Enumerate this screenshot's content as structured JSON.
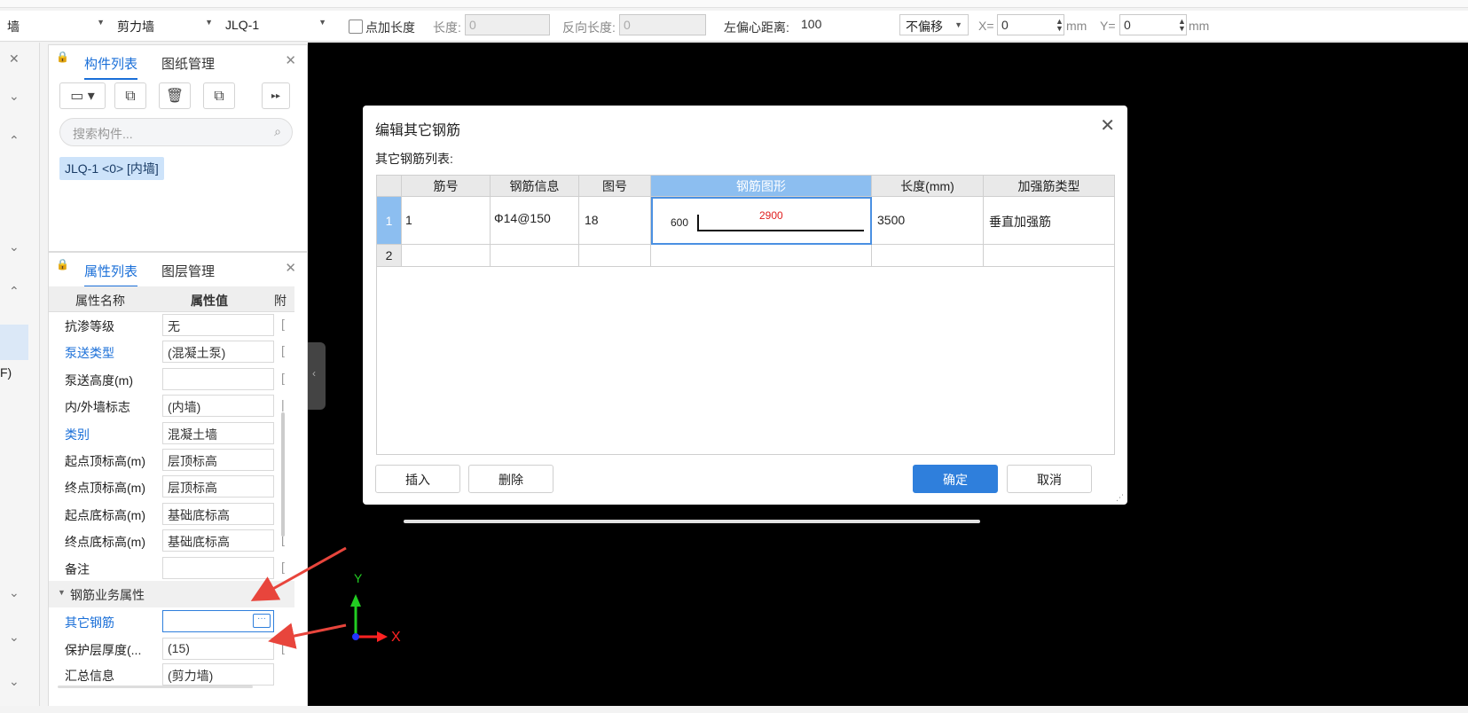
{
  "toolbar": {
    "combo1": "墙",
    "combo2": "剪力墙",
    "combo3": "JLQ-1",
    "point_length_label": "点加长度",
    "length_label": "长度:",
    "length_value": "0",
    "reverse_length_label": "反向长度:",
    "reverse_length_value": "0",
    "left_offset_label": "左偏心距离:",
    "left_offset_value": "100",
    "offset_mode": "不偏移",
    "x_label": "X=",
    "x_value": "0",
    "y_label": "Y=",
    "y_value": "0",
    "unit": "mm"
  },
  "left_strip": {
    "partial_text": "F)"
  },
  "component_panel": {
    "tab_active": "构件列表",
    "tab_other": "图纸管理",
    "search_placeholder": "搜索构件...",
    "selected_item": "JLQ-1 <0> [内墙]"
  },
  "property_panel": {
    "tab_active": "属性列表",
    "tab_other": "图层管理",
    "col_name": "属性名称",
    "col_value": "属性值",
    "col_extra": "附",
    "rows": [
      {
        "name": "抗渗等级",
        "value": "无",
        "blue": false
      },
      {
        "name": "泵送类型",
        "value": "(混凝土泵)",
        "blue": true
      },
      {
        "name": "泵送高度(m)",
        "value": "",
        "blue": false
      },
      {
        "name": "内/外墙标志",
        "value": "(内墙)",
        "blue": false
      },
      {
        "name": "类别",
        "value": "混凝土墙",
        "blue": true
      },
      {
        "name": "起点顶标高(m)",
        "value": "层顶标高",
        "blue": false
      },
      {
        "name": "终点顶标高(m)",
        "value": "层顶标高",
        "blue": false
      },
      {
        "name": "起点底标高(m)",
        "value": "基础底标高",
        "blue": false
      },
      {
        "name": "终点底标高(m)",
        "value": "基础底标高",
        "blue": false
      },
      {
        "name": "备注",
        "value": "",
        "blue": false
      }
    ],
    "section_title": "钢筋业务属性",
    "other_rebar_label": "其它钢筋",
    "cover_label": "保护层厚度(...",
    "cover_value": "(15)",
    "summary_label": "汇总信息",
    "summary_value": "(剪力墙)"
  },
  "canvas": {
    "axis_y": "Y",
    "axis_x": "X"
  },
  "dialog": {
    "title": "编辑其它钢筋",
    "subtitle": "其它钢筋列表:",
    "columns": [
      "筋号",
      "钢筋信息",
      "图号",
      "钢筋图形",
      "长度(mm)",
      "加强筋类型"
    ],
    "rows": [
      {
        "num": "1",
        "bar_no": "1",
        "info": "Ф14@150",
        "fig": "18",
        "shape_left": "600",
        "shape_top": "2900",
        "length": "3500",
        "type": "垂直加强筋"
      },
      {
        "num": "2",
        "bar_no": "",
        "info": "",
        "fig": "",
        "shape_left": "",
        "shape_top": "",
        "length": "",
        "type": ""
      }
    ],
    "btn_insert": "插入",
    "btn_delete": "删除",
    "btn_ok": "确定",
    "btn_cancel": "取消"
  }
}
